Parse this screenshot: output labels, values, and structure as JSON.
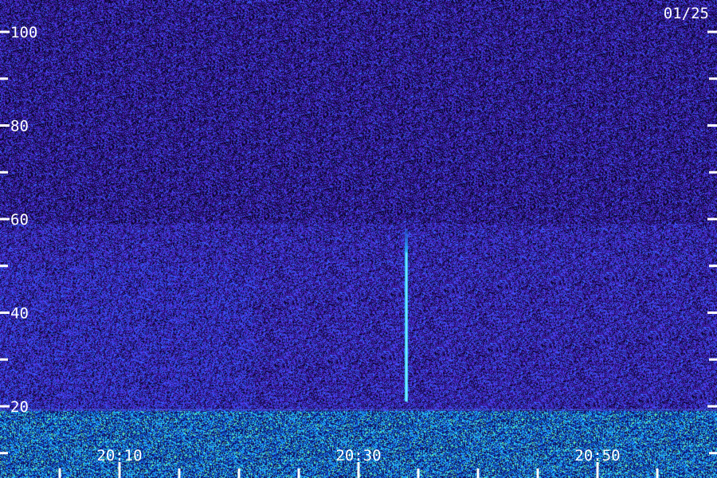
{
  "date_label": "01/25",
  "colors": {
    "background": "#1c0f48",
    "noise": "#5a2dd0",
    "signal": "#28c8ff",
    "band": "#7cff9c",
    "tick": "#ffffff"
  },
  "chart_data": {
    "type": "heatmap",
    "title": "",
    "xlabel": "",
    "ylabel": "",
    "x_ticks": [
      "20:10",
      "20:30",
      "20:50"
    ],
    "x_minor_ticks": [
      "20:05",
      "20:15",
      "20:20",
      "20:25",
      "20:35",
      "20:40",
      "20:45",
      "20:55",
      "21:00"
    ],
    "x_range": [
      "20:00",
      "21:00"
    ],
    "y_ticks": [
      100,
      80,
      60,
      40,
      20
    ],
    "y_minor_ticks": [
      90,
      70,
      50,
      30,
      10
    ],
    "y_range": [
      0,
      104
    ],
    "grid": false,
    "features": [
      {
        "kind": "vertical-streak",
        "time": "20:34",
        "from": 21,
        "to": 58
      },
      {
        "kind": "horizontal-band",
        "time_start": "20:00",
        "time_end": "21:00",
        "from": 0,
        "to": 19
      }
    ]
  }
}
